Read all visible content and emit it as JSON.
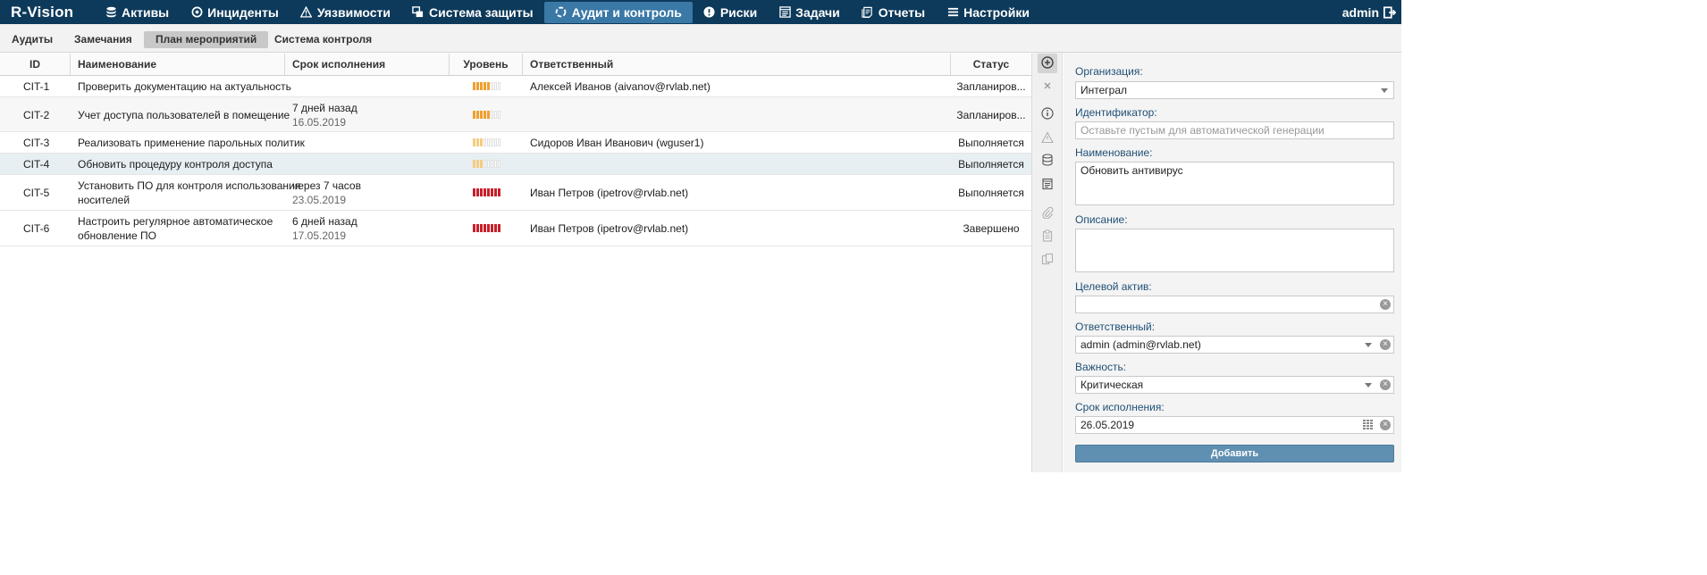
{
  "app": {
    "logo": "R-Vision",
    "user": "admin"
  },
  "nav": [
    {
      "label": "Активы",
      "icon": "database-icon"
    },
    {
      "label": "Инциденты",
      "icon": "target-icon"
    },
    {
      "label": "Уязвимости",
      "icon": "warning-icon"
    },
    {
      "label": "Система защиты",
      "icon": "shield-windows-icon"
    },
    {
      "label": "Аудит и контроль",
      "icon": "audit-cycle-icon",
      "active": true
    },
    {
      "label": "Риски",
      "icon": "exclamation-circle-icon"
    },
    {
      "label": "Задачи",
      "icon": "tasks-icon"
    },
    {
      "label": "Отчеты",
      "icon": "reports-icon"
    },
    {
      "label": "Настройки",
      "icon": "menu-icon"
    }
  ],
  "subtabs": [
    {
      "label": "Аудиты"
    },
    {
      "label": "Замечания"
    },
    {
      "label": "План мероприятий",
      "active": true
    },
    {
      "label": "Система контроля"
    }
  ],
  "table": {
    "columns": [
      "ID",
      "Наименование",
      "Срок исполнения",
      "Уровень",
      "Ответственный",
      "Статус"
    ],
    "rows": [
      {
        "id": "CIT-1",
        "name": [
          "Проверить документацию на актуальность"
        ],
        "due": "",
        "due_date": "",
        "level": 5,
        "level_color": "orange",
        "owner": "Алексей Иванов (aivanov@rvlab.net)",
        "status": "Запланиров..."
      },
      {
        "id": "CIT-2",
        "name": [
          "Учет доступа пользователей в помещение"
        ],
        "due": "7 дней назад",
        "due_date": "16.05.2019",
        "level": 5,
        "level_color": "orange",
        "owner": "",
        "status": "Запланиров..."
      },
      {
        "id": "CIT-3",
        "name": [
          "Реализовать применение парольных политик"
        ],
        "due": "",
        "due_date": "",
        "level": 3,
        "level_color": "light",
        "owner": "Сидоров Иван Иванович (wguser1)",
        "status": "Выполняется"
      },
      {
        "id": "CIT-4",
        "name": [
          "Обновить процедуру контроля доступа"
        ],
        "due": "",
        "due_date": "",
        "level": 3,
        "level_color": "light",
        "owner": "",
        "status": "Выполняется"
      },
      {
        "id": "CIT-5",
        "name": [
          "Установить ПО для контроля использования",
          "носителей"
        ],
        "due": "через 7 часов",
        "due_date": "23.05.2019",
        "level": 8,
        "level_color": "red",
        "owner": "Иван Петров (ipetrov@rvlab.net)",
        "status": "Выполняется"
      },
      {
        "id": "CIT-6",
        "name": [
          "Настроить регулярное автоматическое",
          "обновление ПО"
        ],
        "due": "6 дней назад",
        "due_date": "17.05.2019",
        "level": 8,
        "level_color": "red",
        "owner": "Иван Петров (ipetrov@rvlab.net)",
        "status": "Завершено"
      }
    ]
  },
  "colors": {
    "orange": "#f0a030",
    "light": "#f5cc80",
    "red": "#c8202a",
    "nav_bg": "#0d3a5b",
    "nav_active": "#3a78a6"
  },
  "form": {
    "org_label": "Организация:",
    "org_value": "Интеграл",
    "id_label": "Идентификатор:",
    "id_placeholder": "Оставьте пустым для автоматической генерации",
    "name_label": "Наименование:",
    "name_value": "Обновить антивирус",
    "desc_label": "Описание:",
    "desc_value": "",
    "asset_label": "Целевой актив:",
    "asset_value": "",
    "owner_label": "Ответственный:",
    "owner_value": "admin (admin@rvlab.net)",
    "severity_label": "Важность:",
    "severity_value": "Критическая",
    "due_label": "Срок исполнения:",
    "due_value": "26.05.2019",
    "submit_label": "Добавить"
  }
}
